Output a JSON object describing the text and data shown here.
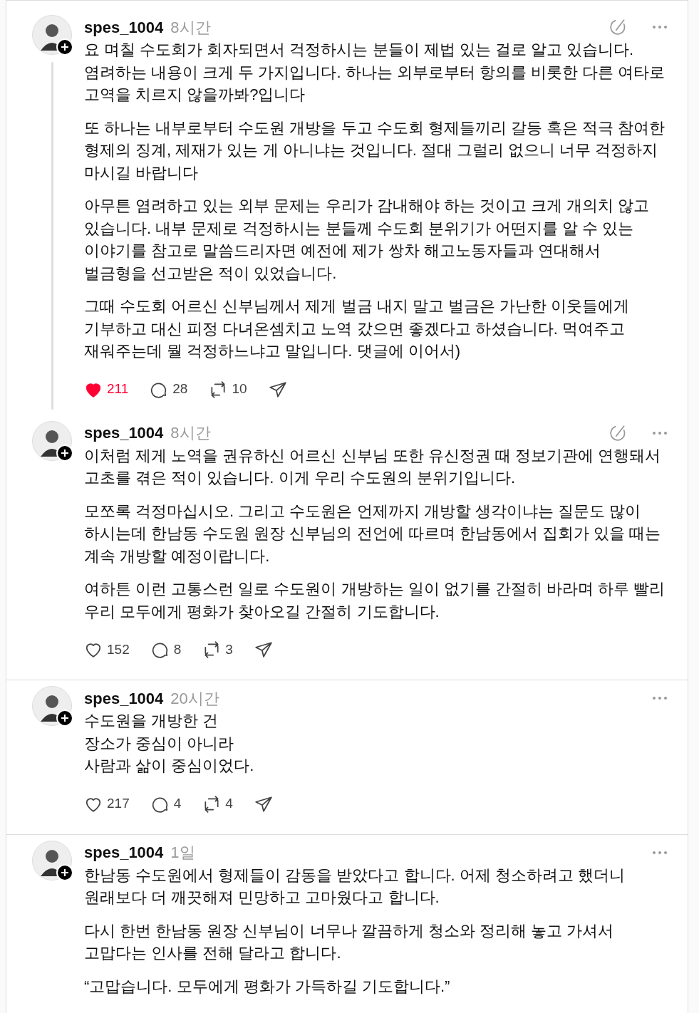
{
  "posts": [
    {
      "author": "spes_1004",
      "time": "8시간",
      "edited": true,
      "thread_continues": true,
      "paragraphs": [
        "요 며칠 수도회가 회자되면서 걱정하시는 분들이 제법 있는 걸로 알고 있습니다. 염려하는 내용이 크게 두 가지입니다. 하나는 외부로부터 항의를 비롯한 다른 여타로 고역을 치르지 않을까봐?입니다",
        "또 하나는 내부로부터 수도원 개방을 두고 수도회 형제들끼리 갈등 혹은 적극 참여한 형제의 징계, 제재가 있는 게 아니냐는 것입니다. 절대 그럴리 없으니 너무 걱정하지 마시길 바랍니다",
        "아무튼 염려하고 있는 외부 문제는 우리가 감내해야 하는 것이고 크게 개의치 않고 있습니다. 내부 문제로 걱정하시는 분들께 수도회 분위기가 어떤지를 알 수 있는 이야기를 참고로 말씀드리자면 예전에 제가 쌍차 해고노동자들과 연대해서 벌금형을 선고받은 적이 있었습니다.",
        "그때 수도회 어르신 신부님께서 제게 벌금 내지 말고 벌금은 가난한 이웃들에게 기부하고 대신 피정 다녀온셈치고 노역 갔으면 좋겠다고 하셨습니다. 먹여주고 재워주는데 뭘 걱정하느냐고 말입니다. 댓글에 이어서)"
      ],
      "likes": "211",
      "liked": true,
      "replies": "28",
      "reposts": "10"
    },
    {
      "author": "spes_1004",
      "time": "8시간",
      "edited": true,
      "thread_continues": false,
      "paragraphs": [
        "이처럼 제게 노역을 권유하신 어르신 신부님 또한 유신정권 때 정보기관에 연행돼서 고초를 겪은 적이 있습니다. 이게 우리 수도원의 분위기입니다.",
        "모쪼록 걱정마십시오. 그리고 수도원은 언제까지 개방할 생각이냐는 질문도 많이 하시는데 한남동 수도원 원장 신부님의 전언에 따르며 한남동에서 집회가 있을 때는 계속 개방할 예정이랍니다.",
        "여하튼 이런 고통스런 일로 수도원이 개방하는 일이 없기를 간절히 바라며 하루 빨리 우리 모두에게 평화가 찾아오길 간절히 기도합니다."
      ],
      "likes": "152",
      "liked": false,
      "replies": "8",
      "reposts": "3"
    },
    {
      "author": "spes_1004",
      "time": "20시간",
      "edited": false,
      "thread_continues": false,
      "paragraphs": [
        "수도원을 개방한 건\n장소가 중심이 아니라\n사람과 삶이 중심이었다."
      ],
      "likes": "217",
      "liked": false,
      "replies": "4",
      "reposts": "4"
    },
    {
      "author": "spes_1004",
      "time": "1일",
      "edited": false,
      "thread_continues": false,
      "paragraphs": [
        "한남동 수도원에서 형제들이 감동을 받았다고 합니다. 어제 청소하려고 했더니 원래보다 더 깨끗해져 민망하고 고마웠다고 합니다.",
        "다시 한번 한남동 원장 신부님이 너무나 깔끔하게 청소와 정리해 놓고 가셔서 고맙다는 인사를 전해 달라고 합니다.",
        "“고맙습니다. 모두에게 평화가 가득하길 기도합니다.”"
      ]
    }
  ]
}
